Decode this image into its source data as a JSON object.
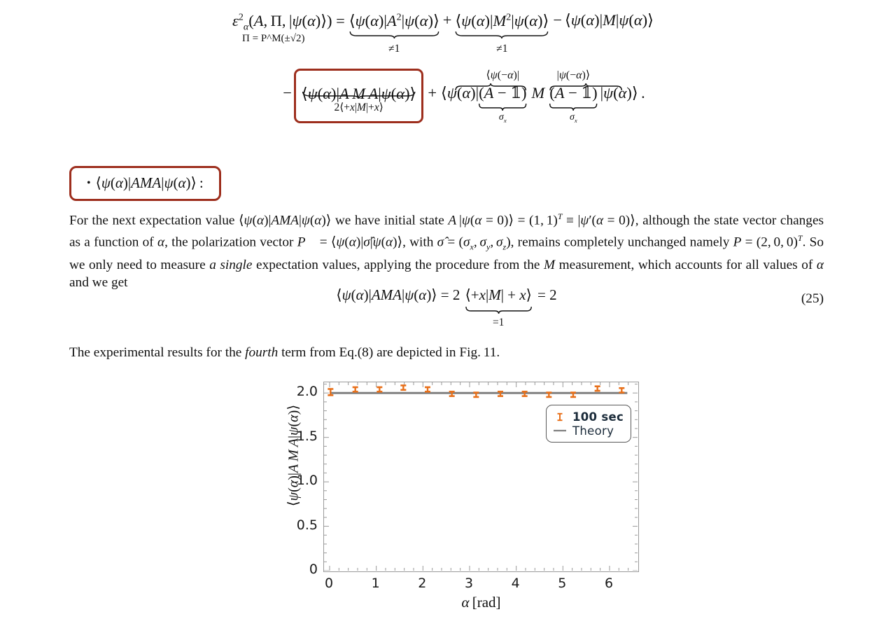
{
  "equation_top": {
    "lhs": "ε²α(A, Π, |ψ(α)⟩) =",
    "lhs_sub": "Π = P^M(±√2)",
    "term1": "⟨ψ(α)|A²|ψ(α)⟩",
    "term1_under": "≠1",
    "plus1": "+",
    "term2": "⟨ψ(α)|M²|ψ(α)⟩",
    "term2_under": "≠1",
    "minus1": "−",
    "term3": "⟨ψ(α)|M|ψ(α)⟩",
    "row2_minus": "−",
    "boxed_term": "⟨ψ(α)|A M A|ψ(α)⟩",
    "boxed_under": "2⟨+x|M|+x⟩",
    "row2_plus": "+",
    "term4a": "⟨ψ(α)|",
    "term4b": "(A − 𝟙)",
    "term4b_over": "⟨ψ(−α)|",
    "term4b_under": "σx",
    "term4c": "M",
    "term4d": "(A − 𝟙)",
    "term4d_over": "|ψ(−α)⟩",
    "term4d_under": "σx",
    "term4e": "|ψ(α)⟩ ."
  },
  "bullet_item": {
    "bullet": "•",
    "text": "⟨ψ(α)|AMA|ψ(α)⟩ :"
  },
  "paragraph1": "For the next expectation value ⟨ψ(α)|AMA|ψ(α)⟩ we have initial state A |ψ(α = 0)⟩ = (1, 1)ᵀ ≡ |ψ′(α = 0)⟩, although the state vector changes as a function of α, the polarization vector P⃗ = ⟨ψ(α)|σ̂|ψ(α)⟩, with σ̂ = (σx, σy, σz), remains completely unchanged namely P = (2, 0, 0)ᵀ. So we only need to measure a single expectation values, applying the procedure from the M measurement, which accounts for all values of α and we get",
  "equation25": {
    "body": "⟨ψ(α)|AMA|ψ(α)⟩ = 2 ⟨+x|M| + x⟩ = 2",
    "under": "=1",
    "number": "(25)"
  },
  "paragraph2": "The experimental results for the fourth term from Eq.(8) are depicted in Fig. 11.",
  "chart_data": {
    "type": "scatter",
    "title": "",
    "xlabel": "α [rad]",
    "ylabel": "⟨ψ(α)|A M A|ψ(α)⟩",
    "xlim": [
      -0.12,
      6.6
    ],
    "ylim": [
      0,
      2.12
    ],
    "grid": false,
    "xticks": [
      0,
      1,
      2,
      3,
      4,
      5,
      6
    ],
    "xtick_labels": [
      "0",
      "1",
      "2",
      "3",
      "4",
      "5",
      "6"
    ],
    "yticks": [
      0,
      0.5,
      1.0,
      1.5,
      2.0
    ],
    "ytick_labels": [
      "0",
      "0.5",
      "1.0",
      "1.5",
      "2.0"
    ],
    "minor_ticks": true,
    "legend": {
      "position": "upper-right",
      "entries": [
        {
          "label": "100 sec",
          "marker": "errorbar",
          "color": "#e8701a",
          "bold": true
        },
        {
          "label": "Theory",
          "marker": "line",
          "color": "#808080",
          "bold": false
        }
      ]
    },
    "series": [
      {
        "name": "100 sec",
        "marker": "errorbar",
        "color": "#e8701a",
        "x": [
          0.02,
          0.55,
          1.07,
          1.58,
          2.1,
          2.62,
          3.14,
          3.66,
          4.18,
          4.7,
          5.22,
          5.74,
          6.26
        ],
        "y": [
          2.01,
          2.04,
          2.04,
          2.06,
          2.04,
          1.99,
          1.98,
          1.99,
          1.99,
          1.98,
          1.98,
          2.05,
          2.03
        ],
        "yerr": [
          0.035,
          0.025,
          0.025,
          0.025,
          0.025,
          0.025,
          0.025,
          0.025,
          0.025,
          0.025,
          0.025,
          0.025,
          0.025
        ]
      },
      {
        "name": "Theory",
        "marker": "line",
        "color": "#808080",
        "x": [
          0,
          6.38
        ],
        "y": [
          2.0,
          2.0
        ]
      }
    ]
  },
  "colors": {
    "highlight_box": "#9d2e1d",
    "data_orange": "#e8701a",
    "theory_gray": "#808080",
    "axis_gray": "#9a9a9a",
    "text": "#111111"
  }
}
